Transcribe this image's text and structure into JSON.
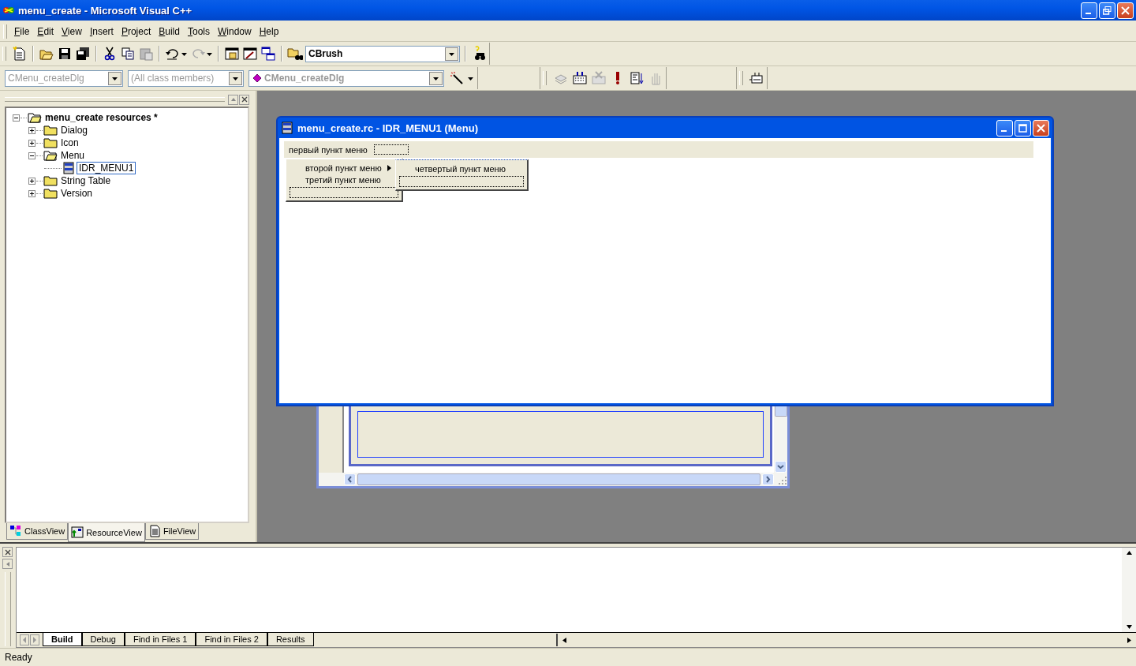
{
  "window": {
    "title": "menu_create - Microsoft Visual C++"
  },
  "menu_bar": [
    "File",
    "Edit",
    "View",
    "Insert",
    "Project",
    "Build",
    "Tools",
    "Window",
    "Help"
  ],
  "toolbar": {
    "find_combo": "CBrush"
  },
  "wizard_bar": {
    "class_combo": "CMenu_createDlg",
    "filter_combo": "(All class members)",
    "member_combo": "CMenu_createDlg"
  },
  "workspace": {
    "tree": [
      {
        "label": "menu_create resources *",
        "expanded": true,
        "children": [
          {
            "label": "Dialog",
            "expanded": false
          },
          {
            "label": "Icon",
            "expanded": false
          },
          {
            "label": "Menu",
            "expanded": true,
            "children": [
              {
                "label": "IDR_MENU1",
                "selected": true
              }
            ]
          },
          {
            "label": "String Table",
            "expanded": false
          },
          {
            "label": "Version",
            "expanded": false
          }
        ]
      }
    ],
    "tabs": [
      {
        "label": "ClassView",
        "selected": false
      },
      {
        "label": "ResourceView",
        "selected": true
      },
      {
        "label": "FileView",
        "selected": false
      }
    ]
  },
  "menu_editor": {
    "title": "menu_create.rc - IDR_MENU1 (Menu)",
    "top_items": [
      "первый пункт меню"
    ],
    "submenu": [
      {
        "label": "второй пункт меню",
        "has_submenu": true
      },
      {
        "label": "третий пункт меню",
        "has_submenu": false
      }
    ],
    "nested_submenu": [
      {
        "label": "четвертый пункт меню",
        "has_submenu": false
      }
    ]
  },
  "output": {
    "tabs": [
      {
        "label": "Build",
        "selected": true
      },
      {
        "label": "Debug",
        "selected": false
      },
      {
        "label": "Find in Files 1",
        "selected": false
      },
      {
        "label": "Find in Files 2",
        "selected": false
      },
      {
        "label": "Results",
        "selected": false
      }
    ]
  },
  "status_bar": {
    "text": "Ready"
  }
}
